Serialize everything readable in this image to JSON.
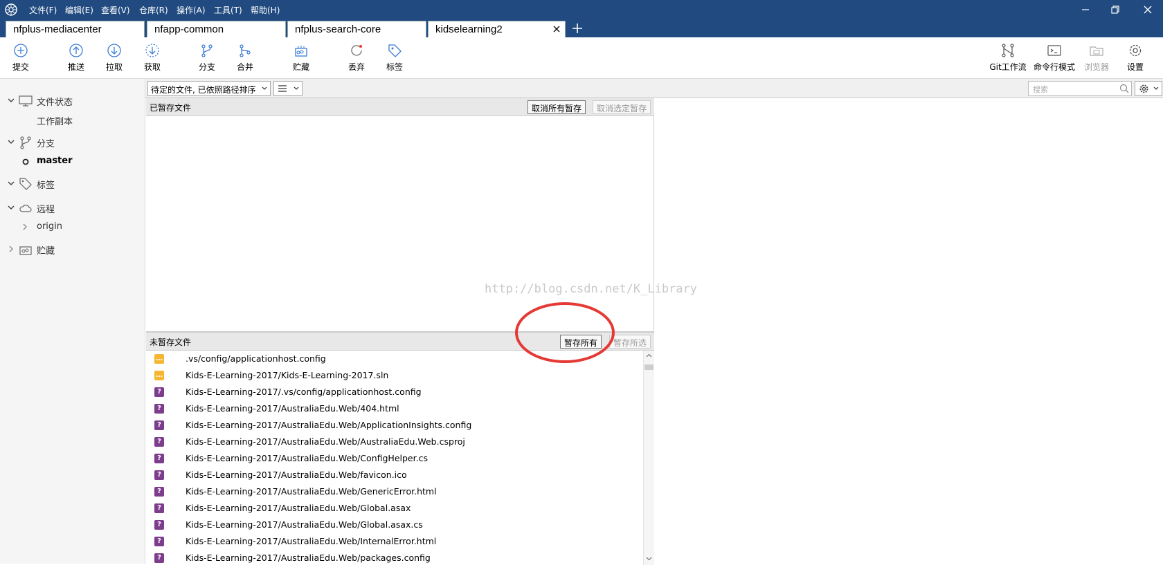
{
  "menu": [
    "文件(F)",
    "编辑(E)",
    "查看(V)",
    "仓库(R)",
    "操作(A)",
    "工具(T)",
    "帮助(H)"
  ],
  "tabs": [
    "nfplus-mediacenter",
    "nfapp-common",
    "nfplus-search-core",
    "kidselearning2"
  ],
  "toolbar": {
    "left": [
      "提交",
      "推送",
      "拉取",
      "获取",
      "分支",
      "合并",
      "贮藏",
      "丢弃",
      "标签"
    ],
    "right": [
      "Git工作流",
      "命令行模式",
      "浏览器",
      "设置"
    ]
  },
  "sidebar": {
    "file_status": "文件状态",
    "working_copy": "工作副本",
    "branches": "分支",
    "master": "master",
    "tags": "标签",
    "remotes": "远程",
    "origin": "origin",
    "stashes": "贮藏"
  },
  "filter": {
    "sort_label": "待定的文件, 已依照路径排序",
    "search_placeholder": "搜索"
  },
  "staged": {
    "title": "已暂存文件",
    "unstage_all": "取消所有暂存",
    "unstage_selected": "取消选定暂存"
  },
  "unstaged": {
    "title": "未暂存文件",
    "stage_all": "暂存所有",
    "stage_selected": "暂存所选"
  },
  "files": [
    {
      "status": "modified",
      "path": ".vs/config/applicationhost.config"
    },
    {
      "status": "modified",
      "path": "Kids-E-Learning-2017/Kids-E-Learning-2017.sln"
    },
    {
      "status": "untracked",
      "path": "Kids-E-Learning-2017/.vs/config/applicationhost.config"
    },
    {
      "status": "untracked",
      "path": "Kids-E-Learning-2017/AustraliaEdu.Web/404.html"
    },
    {
      "status": "untracked",
      "path": "Kids-E-Learning-2017/AustraliaEdu.Web/ApplicationInsights.config"
    },
    {
      "status": "untracked",
      "path": "Kids-E-Learning-2017/AustraliaEdu.Web/AustraliaEdu.Web.csproj"
    },
    {
      "status": "untracked",
      "path": "Kids-E-Learning-2017/AustraliaEdu.Web/ConfigHelper.cs"
    },
    {
      "status": "untracked",
      "path": "Kids-E-Learning-2017/AustraliaEdu.Web/favicon.ico"
    },
    {
      "status": "untracked",
      "path": "Kids-E-Learning-2017/AustraliaEdu.Web/GenericError.html"
    },
    {
      "status": "untracked",
      "path": "Kids-E-Learning-2017/AustraliaEdu.Web/Global.asax"
    },
    {
      "status": "untracked",
      "path": "Kids-E-Learning-2017/AustraliaEdu.Web/Global.asax.cs"
    },
    {
      "status": "untracked",
      "path": "Kids-E-Learning-2017/AustraliaEdu.Web/InternalError.html"
    },
    {
      "status": "untracked",
      "path": "Kids-E-Learning-2017/AustraliaEdu.Web/packages.config"
    }
  ],
  "watermark": "http://blog.csdn.net/K_Library",
  "colors": {
    "titlebar": "#214b80",
    "annotation": "#e53935",
    "modified": "#f5b731",
    "untracked": "#7d3c8c"
  }
}
